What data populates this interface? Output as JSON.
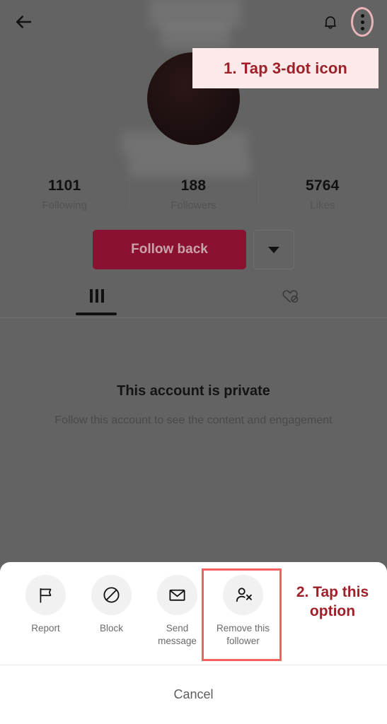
{
  "app": {
    "screen_name": "TikTok profile — remove follower flow",
    "background_color": "#636363",
    "accent_color": "#8a1230",
    "annotation_color": "#9e2029",
    "highlight_box_color": "#f46161",
    "highlight_ring_color": "#e8b4b8",
    "callout_bg_color": "#fce9e9"
  },
  "header": {
    "back_icon": "back-arrow-icon",
    "notifications_icon": "bell-icon",
    "more_icon": "three-dot-icon"
  },
  "profile": {
    "avatar": "redacted-avatar",
    "stats": [
      {
        "value": "1101",
        "label": "Following"
      },
      {
        "value": "188",
        "label": "Followers"
      },
      {
        "value": "5764",
        "label": "Likes"
      }
    ],
    "follow_button": "Follow back",
    "dropdown_icon": "chevron-down-icon",
    "tabs": [
      {
        "id": "posts",
        "icon": "grid-icon",
        "active": true
      },
      {
        "id": "liked",
        "icon": "heart-slash-icon",
        "active": false
      }
    ],
    "private_title": "This account is private",
    "private_subtitle": "Follow this account to see the content and engagement"
  },
  "sheet": {
    "items": [
      {
        "icon": "flag-icon",
        "label": "Report",
        "highlighted": false
      },
      {
        "icon": "block-icon",
        "label": "Block",
        "highlighted": false
      },
      {
        "icon": "envelope-icon",
        "label": "Send\nmessage",
        "label_line1": "Send",
        "label_line2": "message",
        "highlighted": false
      },
      {
        "icon": "person-x-icon",
        "label": "Remove this follower",
        "label_line1": "Remove this",
        "label_line2": "follower",
        "highlighted": true
      }
    ],
    "cancel_label": "Cancel"
  },
  "annotations": [
    {
      "id": "step-1",
      "text": "1. Tap 3-dot icon",
      "target": "three-dot-icon"
    },
    {
      "id": "step-2",
      "line1": "2. Tap this",
      "line2": "option",
      "target": "remove-this-follower-option"
    }
  ]
}
